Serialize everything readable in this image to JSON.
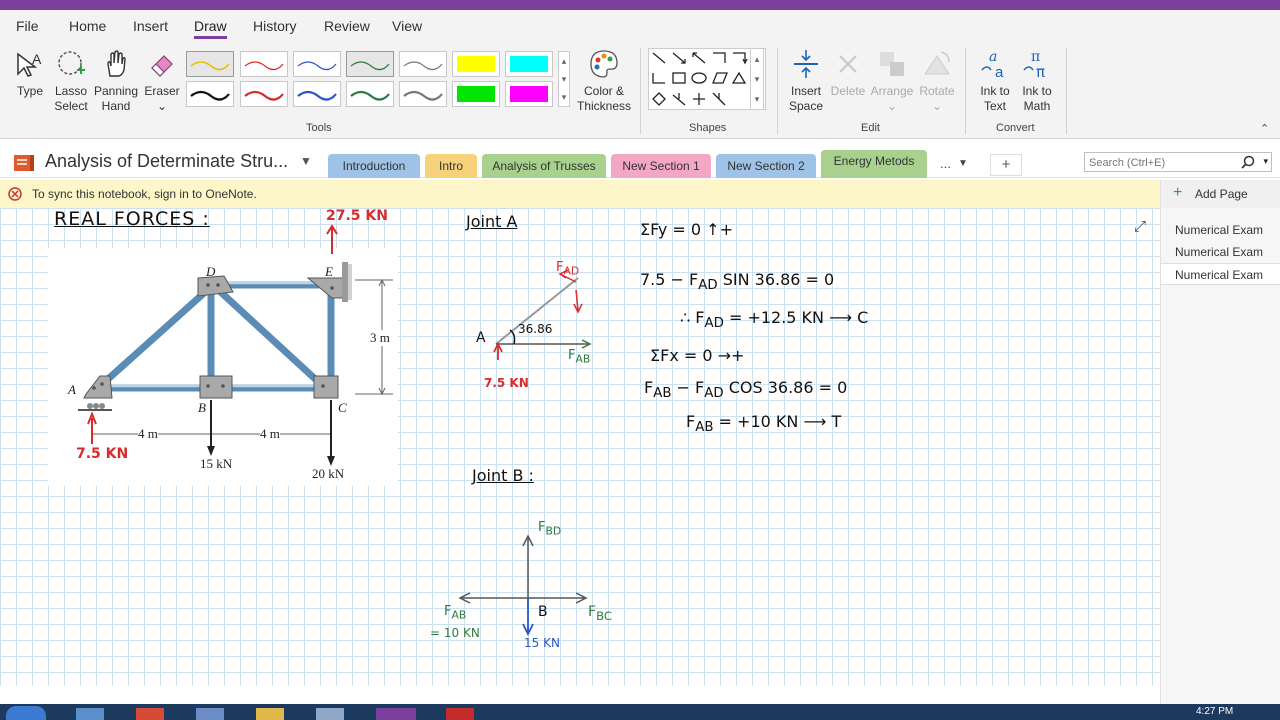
{
  "menu": [
    "File",
    "Home",
    "Insert",
    "Draw",
    "History",
    "Review",
    "View"
  ],
  "tools": {
    "type": "Type",
    "lasso": [
      "Lasso",
      "Select"
    ],
    "panning": [
      "Panning",
      "Hand"
    ],
    "eraser": "Eraser",
    "color": [
      "Color &",
      "Thickness"
    ],
    "group": "Tools"
  },
  "shapes_group": "Shapes",
  "edit": {
    "insert_space": [
      "Insert",
      "Space"
    ],
    "delete": "Delete",
    "arrange": "Arrange",
    "rotate": "Rotate",
    "group": "Edit"
  },
  "convert": {
    "ink_to_text": [
      "Ink to",
      "Text"
    ],
    "ink_to_math": [
      "Ink to",
      "Math"
    ],
    "group": "Convert"
  },
  "notebook": {
    "title": "Analysis of Determinate Stru...",
    "more": "...",
    "add": "+"
  },
  "tabs": [
    {
      "label": "Introduction",
      "color": "#9ec3e6"
    },
    {
      "label": "Intro",
      "color": "#f6d27a"
    },
    {
      "label": "Analysis of Trusses",
      "color": "#a9d18e"
    },
    {
      "label": "New Section 1",
      "color": "#f4a7c4"
    },
    {
      "label": "New Section 2",
      "color": "#9ec3e6"
    },
    {
      "label": "Energy Metods",
      "color": "#a9d18e"
    }
  ],
  "search_placeholder": "Search (Ctrl+E)",
  "sync_message": "To sync this notebook, sign in to OneNote.",
  "add_page": "Add Page",
  "pages": [
    "Numerical Exam",
    "Numerical Exam",
    "Numerical Exam"
  ],
  "taskbar_time": "4:27 PM",
  "note": {
    "real_forces": "REAL FORCES :",
    "top_force": "27.5 KN",
    "truss": {
      "nodeA": "A",
      "nodeB": "B",
      "nodeC": "C",
      "nodeD": "D",
      "nodeE": "E",
      "height": "3 m",
      "span1": "4 m",
      "span2": "4 m",
      "load1": "15 kN",
      "load2": "20 kN",
      "reaction": "7.5 KN"
    },
    "joint_a": {
      "title": "Joint A",
      "fad": "F",
      "fad_sub": "AD",
      "angle": "36.86",
      "node": "A",
      "fab": "F",
      "fab_sub": "AB",
      "reaction": "7.5 KN"
    },
    "equations": {
      "e1": "ΣFy = 0  ↑+",
      "e2": "7.5 − F",
      "e2_sub": "AD",
      "e2_tail": " SIN 36.86 = 0",
      "e3": "∴ F",
      "e3_sub": "AD",
      "e3_tail": " = +12.5 KN ⟶ C",
      "e4": "ΣFx = 0  →+",
      "e5": "F",
      "e5_sub": "AB",
      "e5_mid": " − F",
      "e5_sub2": "AD",
      "e5_tail": " COS 36.86 = 0",
      "e6": "F",
      "e6_sub": "AB",
      "e6_tail": " = +10 KN ⟶ T"
    },
    "joint_b": {
      "title": "Joint B :",
      "fbd": "F",
      "fbd_sub": "BD",
      "fab": "F",
      "fab_sub": "AB",
      "fab_val": "= 10 KN",
      "node": "B",
      "fbc": "F",
      "fbc_sub": "BC",
      "load": "15 KN"
    }
  }
}
